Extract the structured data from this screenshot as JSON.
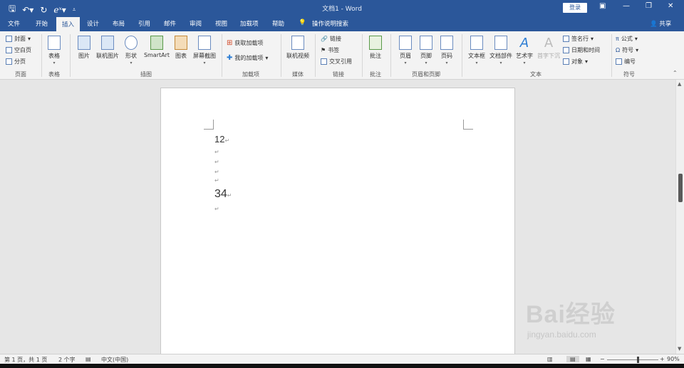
{
  "titlebar": {
    "title": "文档1 - Word",
    "login_label": "登录",
    "qat_icons": [
      "save-icon",
      "undo-icon",
      "redo-icon",
      "equation-icon",
      "customize-qat-icon"
    ],
    "window_controls": [
      "ribbon-display-icon",
      "minimize-icon",
      "restore-icon",
      "close-icon"
    ]
  },
  "tabs": {
    "items": [
      "文件",
      "开始",
      "插入",
      "设计",
      "布局",
      "引用",
      "邮件",
      "审阅",
      "视图",
      "加载项",
      "帮助"
    ],
    "active": "插入",
    "tell_me": "操作说明搜索",
    "share": "共享"
  },
  "ribbon": {
    "pages": {
      "cover": "封面",
      "blank": "空白页",
      "break": "分页",
      "label": "页面"
    },
    "tables": {
      "table": "表格",
      "label": "表格"
    },
    "illustrations": {
      "picture": "图片",
      "online_picture": "联机图片",
      "shapes": "形状",
      "smartart": "SmartArt",
      "chart": "图表",
      "screenshot": "屏幕截图",
      "label": "插图"
    },
    "addins": {
      "get": "获取加载项",
      "my": "我的加载项",
      "label": "加载项"
    },
    "media": {
      "online_video": "联机视频",
      "label": "媒体"
    },
    "links": {
      "link": "链接",
      "bookmark": "书签",
      "cross_ref": "交叉引用",
      "label": "链接"
    },
    "comments": {
      "comment": "批注",
      "label": "批注"
    },
    "header_footer": {
      "header": "页眉",
      "footer": "页脚",
      "page_number": "页码",
      "label": "页眉和页脚"
    },
    "text": {
      "textbox": "文本框",
      "quick_parts": "文档部件",
      "wordart": "艺术字",
      "dropcap": "首字下沉",
      "signature": "签名行",
      "datetime": "日期和时间",
      "object": "对象",
      "label": "文本"
    },
    "symbols": {
      "equation": "公式",
      "symbol": "符号",
      "number": "编号",
      "label": "符号"
    }
  },
  "document": {
    "paragraphs": [
      {
        "text": "12",
        "size": "large"
      },
      {
        "text": "",
        "size": "small"
      },
      {
        "text": "",
        "size": "small"
      },
      {
        "text": "",
        "size": "small"
      },
      {
        "text": "",
        "size": "small"
      },
      {
        "text": "34",
        "size": "xlarge"
      },
      {
        "text": "",
        "size": "small"
      }
    ],
    "paragraph_mark": "↵"
  },
  "status": {
    "page": "第 1 页，共 1 页",
    "words": "2 个字",
    "language": "中文(中国)",
    "zoom": "90%",
    "zoom_fraction": 0.6
  },
  "watermark": {
    "brand": "Bai经验",
    "url": "jingyan.baidu.com"
  }
}
